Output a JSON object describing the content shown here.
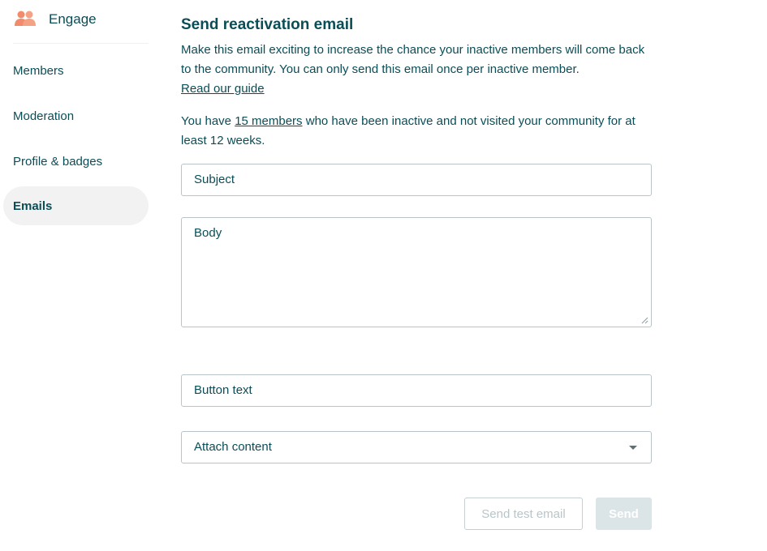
{
  "sidebar": {
    "brand": {
      "label": "Engage",
      "icon": "people-icon",
      "icon_color": "#f28b6b"
    },
    "items": [
      {
        "label": "Members",
        "active": false
      },
      {
        "label": "Moderation",
        "active": false
      },
      {
        "label": "Profile & badges",
        "active": false
      },
      {
        "label": "Emails",
        "active": true
      }
    ]
  },
  "main": {
    "title": "Send reactivation email",
    "description": "Make this email exciting to increase the chance your inactive members will come back to the community. You can only send this email once per inactive member.",
    "guide_link": "Read our guide",
    "inactive_prefix": "You have",
    "inactive_link": "15 members",
    "inactive_suffix": "who have been inactive and not visited your community for at least 12 weeks.",
    "subject_placeholder": "Subject",
    "body_placeholder": "Body",
    "button_text_placeholder": "Button text",
    "attach_content_label": "Attach content",
    "send_test_label": "Send test email",
    "send_label": "Send"
  },
  "colors": {
    "text": "#0b4d56",
    "accent": "#f28b6b",
    "disabled_button": "#dbe4e6"
  }
}
